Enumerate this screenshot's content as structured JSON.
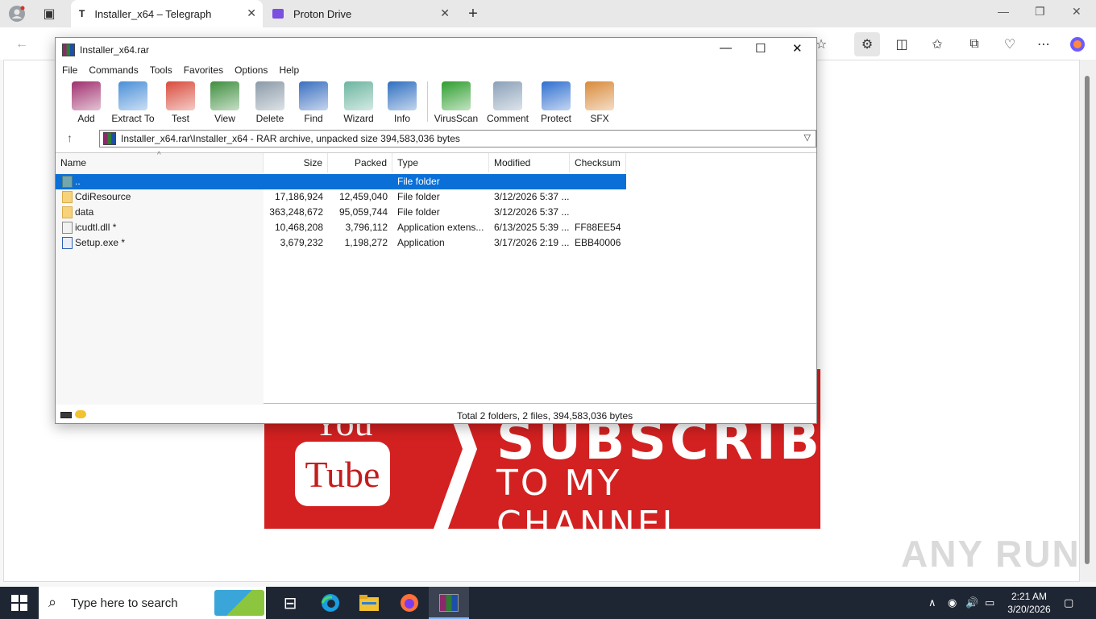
{
  "browser": {
    "tabs": [
      {
        "icon": "T",
        "title": "Installer_x64 – Telegraph"
      },
      {
        "icon": "proton-drive-icon",
        "title": "Proton Drive"
      }
    ]
  },
  "winrar": {
    "title": "Installer_x64.rar",
    "menu": [
      "File",
      "Commands",
      "Tools",
      "Favorites",
      "Options",
      "Help"
    ],
    "toolbar": [
      {
        "label": "Add",
        "color": "#a0306e"
      },
      {
        "label": "Extract To",
        "color": "#4a8fd8"
      },
      {
        "label": "Test",
        "color": "#d94b3c"
      },
      {
        "label": "View",
        "color": "#3e8e3e"
      },
      {
        "label": "Delete",
        "color": "#8a9aa8"
      },
      {
        "label": "Find",
        "color": "#3a6fc0"
      },
      {
        "label": "Wizard",
        "color": "#6bb5a0"
      },
      {
        "label": "Info",
        "color": "#2f6fc0"
      },
      {
        "label": "VirusScan",
        "color": "#2e9e2e"
      },
      {
        "label": "Comment",
        "color": "#8aa0b8"
      },
      {
        "label": "Protect",
        "color": "#2f6fd0"
      },
      {
        "label": "SFX",
        "color": "#d98a3a"
      }
    ],
    "address": "Installer_x64.rar\\Installer_x64 - RAR archive, unpacked size 394,583,036 bytes",
    "columns": [
      "Name",
      "Size",
      "Packed",
      "Type",
      "Modified",
      "Checksum"
    ],
    "rows": [
      {
        "name": "..",
        "size": "",
        "packed": "",
        "type": "File folder",
        "modified": "",
        "checksum": "",
        "icon": "upfolder"
      },
      {
        "name": "CdiResource",
        "size": "17,186,924",
        "packed": "12,459,040",
        "type": "File folder",
        "modified": "3/12/2026 5:37 ...",
        "checksum": "",
        "icon": "folder"
      },
      {
        "name": "data",
        "size": "363,248,672",
        "packed": "95,059,744",
        "type": "File folder",
        "modified": "3/12/2026 5:37 ...",
        "checksum": "",
        "icon": "folder"
      },
      {
        "name": "icudtl.dll *",
        "size": "10,468,208",
        "packed": "3,796,112",
        "type": "Application extens...",
        "modified": "6/13/2025 5:39 ...",
        "checksum": "FF88EE54",
        "icon": "dll"
      },
      {
        "name": "Setup.exe *",
        "size": "3,679,232",
        "packed": "1,198,272",
        "type": "Application",
        "modified": "3/17/2026 2:19 ...",
        "checksum": "EBB40006",
        "icon": "exe"
      }
    ],
    "status": "Total 2 folders, 2 files, 394,583,036 bytes"
  },
  "banner": {
    "you": "You",
    "tube": "Tube",
    "subscribe": "SUBSCRIBE",
    "channel": "TO MY CHANNEL"
  },
  "watermark": "ANY RUN",
  "taskbar": {
    "search_placeholder": "Type here to search",
    "time": "2:21 AM",
    "date": "3/20/2026"
  }
}
